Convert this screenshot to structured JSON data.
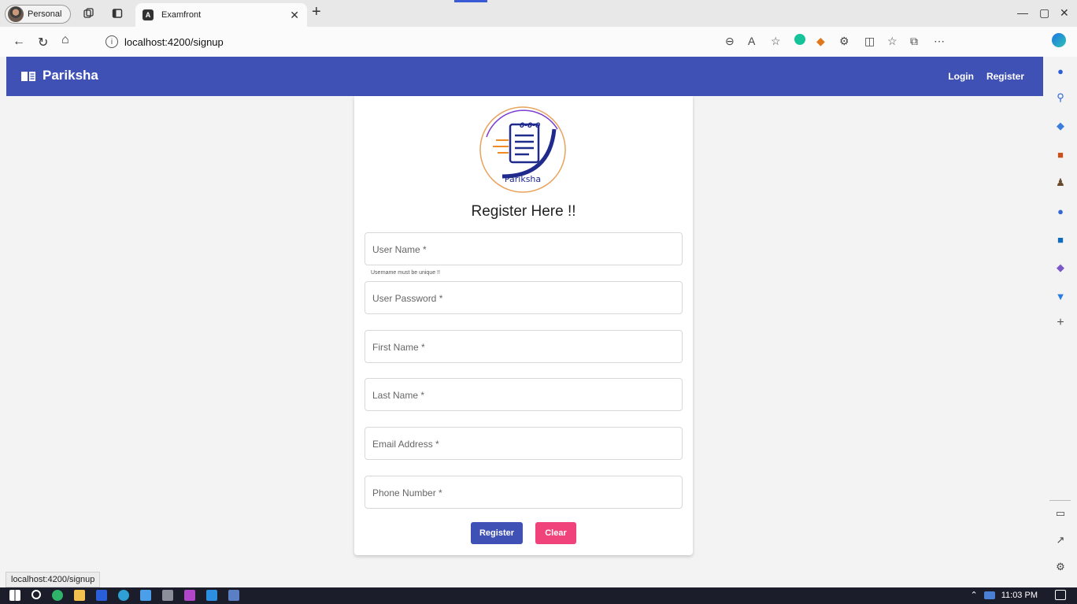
{
  "browser": {
    "profile_label": "Personal",
    "tab_title": "Examfront",
    "tab_favicon": "A",
    "url": "localhost:4200/signup"
  },
  "app": {
    "brand": "Pariksha",
    "nav": {
      "login": "Login",
      "register": "Register"
    },
    "colors": {
      "primary": "#3f51b5",
      "warn": "#f0437c"
    }
  },
  "form": {
    "logo_text": "Pariksha",
    "logo_digits": "0-0-0",
    "title": "Register Here !!",
    "username_label": "User Name *",
    "username_hint": "Username must be unique !!",
    "password_label": "User Password *",
    "firstname_label": "First Name *",
    "lastname_label": "Last Name *",
    "email_label": "Email Address *",
    "phone_label": "Phone Number *",
    "register_button": "Register",
    "clear_button": "Clear"
  },
  "status_bar": {
    "link_preview": "localhost:4200/signup"
  },
  "taskbar": {
    "time": "11:03 PM"
  }
}
